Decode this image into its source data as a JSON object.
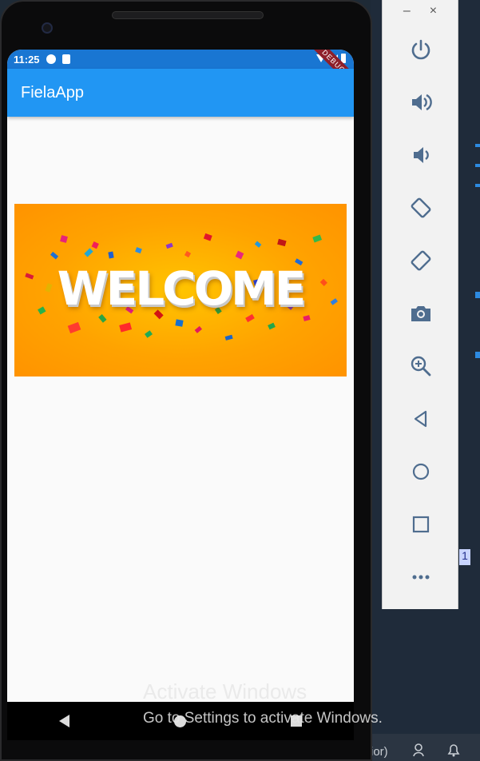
{
  "status_bar": {
    "time": "11:25",
    "debug_label": "DEBUG"
  },
  "app_bar": {
    "title": "FielaApp"
  },
  "banner": {
    "text": "WELCOME"
  },
  "watermark": {
    "title": "Activate Windows",
    "subtitle": "Go to Settings to activate Windows."
  },
  "emulator_panel": {
    "window_controls": [
      "–",
      "×"
    ],
    "tools": [
      {
        "name": "power-icon"
      },
      {
        "name": "volume-up-icon"
      },
      {
        "name": "volume-down-icon"
      },
      {
        "name": "rotate-left-icon"
      },
      {
        "name": "rotate-right-icon"
      },
      {
        "name": "camera-icon"
      },
      {
        "name": "zoom-icon"
      },
      {
        "name": "back-icon"
      },
      {
        "name": "home-icon"
      },
      {
        "name": "overview-icon"
      },
      {
        "name": "more-icon"
      }
    ]
  },
  "ide": {
    "bottom_text": "ior)",
    "side_label": "1"
  },
  "colors": {
    "app_bar": "#2196f3",
    "status_bar": "#1976d2",
    "banner_orange": "#ffa300",
    "panel_icon": "#4f6d8f"
  }
}
